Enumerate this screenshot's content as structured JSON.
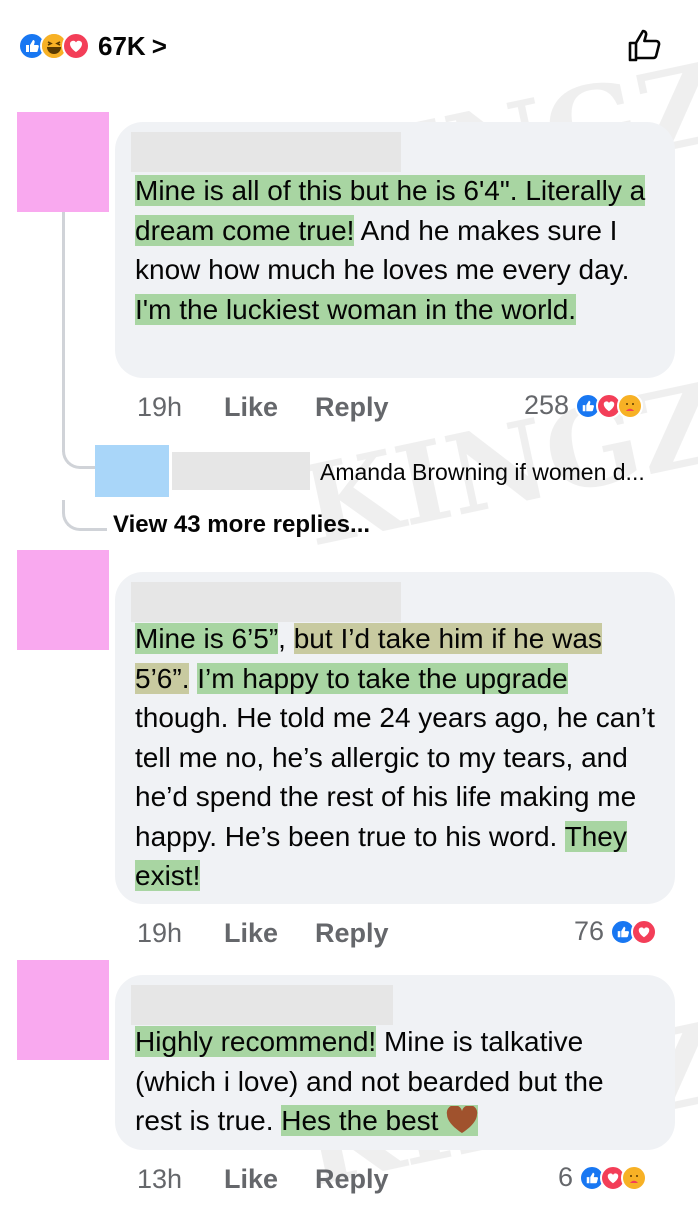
{
  "header": {
    "reaction_count": "67K",
    "chevron": ">"
  },
  "watermark": {
    "word": "KINGZ"
  },
  "comments": [
    {
      "segments": [
        {
          "text": "Mine is all of this but he is 6'4\". Literally a dream come true!",
          "hl": "green"
        },
        {
          "text": " And he makes sure I know how much he loves me every day. ",
          "hl": "none"
        },
        {
          "text": "I'm the luckiest woman in the world.",
          "hl": "green"
        }
      ],
      "time": "19h",
      "like_label": "Like",
      "reply_label": "Reply",
      "reactions_count": "258",
      "reaction_icons": [
        "like-icon",
        "love-icon",
        "care-icon"
      ]
    },
    {
      "segments": [
        {
          "text": "Mine is 6’5”",
          "hl": "green"
        },
        {
          "text": ", ",
          "hl": "none"
        },
        {
          "text": "but I’d take him if he was 5’6”.",
          "hl": "olive"
        },
        {
          "text": " ",
          "hl": "none"
        },
        {
          "text": "I’m happy to take the upgrade",
          "hl": "green"
        },
        {
          "text": " though. He told me 24 years ago, he can’t tell me no, he’s allergic to my tears, and he’d spend the rest of his life making me happy. He’s been true to his word. ",
          "hl": "none"
        },
        {
          "text": "They exist!",
          "hl": "green"
        }
      ],
      "time": "19h",
      "like_label": "Like",
      "reply_label": "Reply",
      "reactions_count": "76",
      "reaction_icons": [
        "like-icon",
        "love-icon"
      ]
    },
    {
      "segments": [
        {
          "text": "Highly recommend!",
          "hl": "green"
        },
        {
          "text": "  Mine is talkative (which i love) and not bearded  but the rest is true. ",
          "hl": "none"
        },
        {
          "text": "Hes the best",
          "hl": "green"
        }
      ],
      "heart_color": "#a0522d",
      "time": "13h",
      "like_label": "Like",
      "reply_label": "Reply",
      "reactions_count": "6",
      "reaction_icons": [
        "like-icon",
        "love-icon",
        "care-icon"
      ]
    }
  ],
  "reply_thread": {
    "preview_text": "Amanda Browning if women d...",
    "view_more": "View 43 more replies..."
  },
  "colors": {
    "highlight_green": "#a8d5a2",
    "highlight_olive": "#c8caa0",
    "bubble": "#f0f2f5",
    "like_blue": "#1877f2",
    "love_red": "#f33e58",
    "avatar_pink": "#f9a9ef",
    "avatar_blue": "#a9d6f9"
  }
}
